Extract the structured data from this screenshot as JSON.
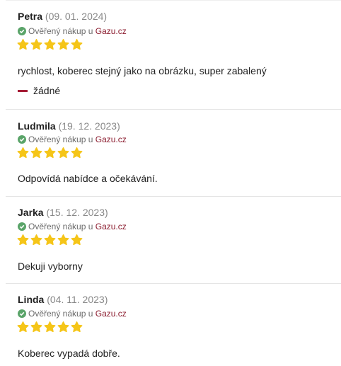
{
  "reviews": [
    {
      "name": "Petra",
      "date": "(09. 01. 2024)",
      "verified_text": "Ověřený nákup u",
      "shop": "Gazu.cz",
      "rating": 5,
      "text": "rychlost, koberec stejný jako na obrázku, super zabalený",
      "cons": "žádné"
    },
    {
      "name": "Ludmila",
      "date": "(19. 12. 2023)",
      "verified_text": "Ověřený nákup u",
      "shop": "Gazu.cz",
      "rating": 5,
      "text": "Odpovídá nabídce a očekávání."
    },
    {
      "name": "Jarka",
      "date": "(15. 12. 2023)",
      "verified_text": "Ověřený nákup u",
      "shop": "Gazu.cz",
      "rating": 5,
      "text": "Dekuji vyborny"
    },
    {
      "name": "Linda",
      "date": "(04. 11. 2023)",
      "verified_text": "Ověřený nákup u",
      "shop": "Gazu.cz",
      "rating": 5,
      "text": "Koberec vypadá dobře."
    }
  ],
  "colors": {
    "star": "#f5c518",
    "verified_check": "#5aa469",
    "shop_link": "#8b1b2e",
    "cons_marker": "#a51d36"
  }
}
